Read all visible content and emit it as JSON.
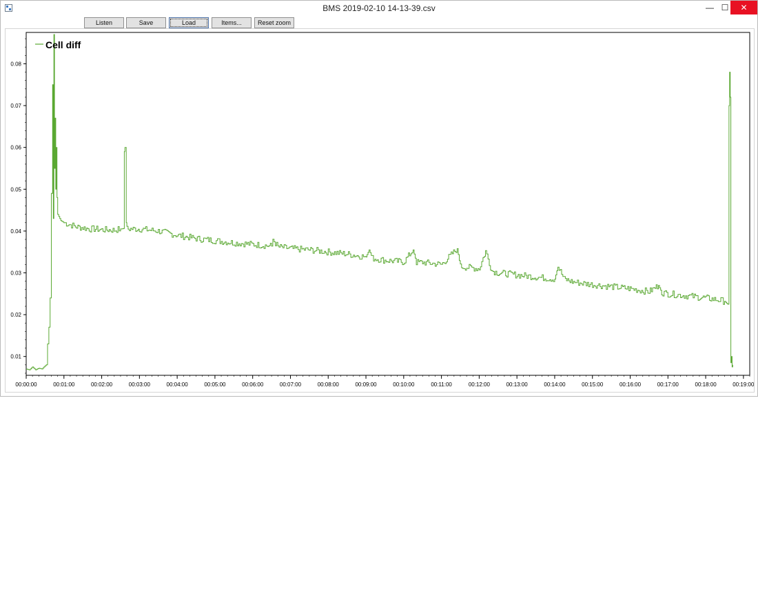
{
  "window": {
    "title": "BMS 2019-02-10 14-13-39.csv",
    "minimize_glyph": "—",
    "maximize_glyph": "☐",
    "close_glyph": "✕",
    "close_color": "#e81123"
  },
  "toolbar": {
    "listen_label": "Listen",
    "save_label": "Save",
    "load_label": "Load",
    "items_label": "Items...",
    "reset_zoom_label": "Reset zoom"
  },
  "chart_data": {
    "type": "line",
    "title": "",
    "xlabel": "",
    "ylabel": "",
    "x_unit": "time hh:mm:ss",
    "x_tick_labels": [
      "00:00:00",
      "00:01:00",
      "00:02:00",
      "00:03:00",
      "00:04:00",
      "00:05:00",
      "00:06:00",
      "00:07:00",
      "00:08:00",
      "00:09:00",
      "00:10:00",
      "00:11:00",
      "00:12:00",
      "00:13:00",
      "00:14:00",
      "00:15:00",
      "00:16:00",
      "00:17:00",
      "00:18:00",
      "00:19:00"
    ],
    "y_tick_labels": [
      "0.01",
      "0.02",
      "0.03",
      "0.04",
      "0.05",
      "0.06",
      "0.07",
      "0.08"
    ],
    "xlim": [
      "00:00:00",
      "00:19:10"
    ],
    "ylim": [
      0.0055,
      0.0875
    ],
    "grid": false,
    "legend_position": "top-left",
    "step_style": true,
    "series": [
      {
        "name": "Cell diff",
        "color": "#5aa832",
        "points": [
          [
            "00:00:00",
            0.007
          ],
          [
            "00:00:05",
            0.0068
          ],
          [
            "00:00:10",
            0.0075
          ],
          [
            "00:00:15",
            0.0068
          ],
          [
            "00:00:20",
            0.0072
          ],
          [
            "00:00:25",
            0.007
          ],
          [
            "00:00:30",
            0.0078
          ],
          [
            "00:00:32",
            0.008
          ],
          [
            "00:00:34",
            0.013
          ],
          [
            "00:00:36",
            0.017
          ],
          [
            "00:00:38",
            0.024
          ],
          [
            "00:00:40",
            0.049
          ],
          [
            "00:00:42",
            0.075
          ],
          [
            "00:00:43",
            0.043
          ],
          [
            "00:00:44",
            0.087
          ],
          [
            "00:00:45",
            0.055
          ],
          [
            "00:00:46",
            0.067
          ],
          [
            "00:00:47",
            0.05
          ],
          [
            "00:00:48",
            0.06
          ],
          [
            "00:00:49",
            0.048
          ],
          [
            "00:00:50",
            0.044
          ],
          [
            "00:00:55",
            0.0425
          ],
          [
            "00:01:00",
            0.042
          ],
          [
            "00:01:10",
            0.0415
          ],
          [
            "00:01:20",
            0.041
          ],
          [
            "00:01:30",
            0.0408
          ],
          [
            "00:01:40",
            0.0405
          ],
          [
            "00:01:50",
            0.0405
          ],
          [
            "00:02:00",
            0.0403
          ],
          [
            "00:02:10",
            0.0403
          ],
          [
            "00:02:20",
            0.0402
          ],
          [
            "00:02:30",
            0.0405
          ],
          [
            "00:02:35",
            0.0406
          ],
          [
            "00:02:36",
            0.059
          ],
          [
            "00:02:37",
            0.06
          ],
          [
            "00:02:39",
            0.042
          ],
          [
            "00:02:40",
            0.0405
          ],
          [
            "00:03:00",
            0.0405
          ],
          [
            "00:03:30",
            0.04
          ],
          [
            "00:04:00",
            0.039
          ],
          [
            "00:04:30",
            0.0382
          ],
          [
            "00:05:00",
            0.0377
          ],
          [
            "00:05:30",
            0.0372
          ],
          [
            "00:06:00",
            0.0368
          ],
          [
            "00:06:30",
            0.0364
          ],
          [
            "00:06:32",
            0.038
          ],
          [
            "00:06:40",
            0.0362
          ],
          [
            "00:07:00",
            0.0358
          ],
          [
            "00:07:30",
            0.0355
          ],
          [
            "00:08:00",
            0.035
          ],
          [
            "00:08:30",
            0.0345
          ],
          [
            "00:09:00",
            0.0338
          ],
          [
            "00:09:05",
            0.0355
          ],
          [
            "00:09:10",
            0.0335
          ],
          [
            "00:09:30",
            0.033
          ],
          [
            "00:10:00",
            0.0326
          ],
          [
            "00:10:15",
            0.0355
          ],
          [
            "00:10:20",
            0.0325
          ],
          [
            "00:10:30",
            0.0325
          ],
          [
            "00:11:00",
            0.032
          ],
          [
            "00:11:25",
            0.0358
          ],
          [
            "00:11:30",
            0.0315
          ],
          [
            "00:12:00",
            0.031
          ],
          [
            "00:12:10",
            0.0352
          ],
          [
            "00:12:20",
            0.0305
          ],
          [
            "00:12:30",
            0.03
          ],
          [
            "00:13:00",
            0.0295
          ],
          [
            "00:13:30",
            0.029
          ],
          [
            "00:14:00",
            0.0285
          ],
          [
            "00:14:05",
            0.0315
          ],
          [
            "00:14:15",
            0.0285
          ],
          [
            "00:14:30",
            0.0278
          ],
          [
            "00:15:00",
            0.0272
          ],
          [
            "00:15:30",
            0.0267
          ],
          [
            "00:16:00",
            0.0262
          ],
          [
            "00:16:30",
            0.0255
          ],
          [
            "00:16:45",
            0.027
          ],
          [
            "00:16:50",
            0.0253
          ],
          [
            "00:17:00",
            0.025
          ],
          [
            "00:17:30",
            0.0245
          ],
          [
            "00:18:00",
            0.024
          ],
          [
            "00:18:20",
            0.0235
          ],
          [
            "00:18:30",
            0.0232
          ],
          [
            "00:18:35",
            0.0225
          ],
          [
            "00:18:37",
            0.07
          ],
          [
            "00:18:38",
            0.078
          ],
          [
            "00:18:39",
            0.072
          ],
          [
            "00:18:40",
            0.0085
          ],
          [
            "00:18:41",
            0.01
          ],
          [
            "00:18:42",
            0.0075
          ],
          [
            "00:18:43",
            0.008
          ]
        ]
      }
    ]
  }
}
